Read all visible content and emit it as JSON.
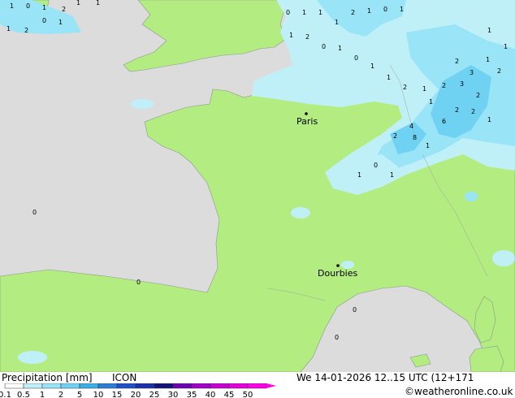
{
  "map": {
    "cities": [
      {
        "name": "Paris"
      },
      {
        "name": "Dourbies"
      }
    ],
    "precip_label_values": [
      "1",
      "0",
      "1",
      "2",
      "1",
      "1",
      "1",
      "2",
      "0",
      "1",
      "0",
      "1",
      "1",
      "1",
      "2",
      "1",
      "0",
      "1",
      "1",
      "2",
      "0",
      "1",
      "0",
      "1",
      "1",
      "2",
      "1",
      "2",
      "3",
      "2",
      "4",
      "6",
      "2",
      "8",
      "1",
      "1",
      "2",
      "2",
      "1",
      "1",
      "1",
      "1",
      "2",
      "3",
      "2",
      "1",
      "0",
      "1",
      "0",
      "0",
      "0",
      "0"
    ]
  },
  "footer": {
    "title": "Precipitation [mm]",
    "model": "ICON",
    "datetime": "We 14-01-2026 12..15 UTC (12+171",
    "credit": "©weatheronline.co.uk",
    "legend": {
      "ticks": [
        "0.1",
        "0.5",
        "1",
        "2",
        "5",
        "10",
        "15",
        "20",
        "25",
        "30",
        "35",
        "40",
        "45",
        "50"
      ],
      "colors": [
        "#ffffff",
        "#bff0f8",
        "#99e4f6",
        "#6fd2f2",
        "#3aaee6",
        "#2b7ed6",
        "#1e50c8",
        "#1b2fa8",
        "#141478",
        "#6e00b4",
        "#a000c8",
        "#c800d2",
        "#e600dc",
        "#ff00e6"
      ]
    }
  }
}
